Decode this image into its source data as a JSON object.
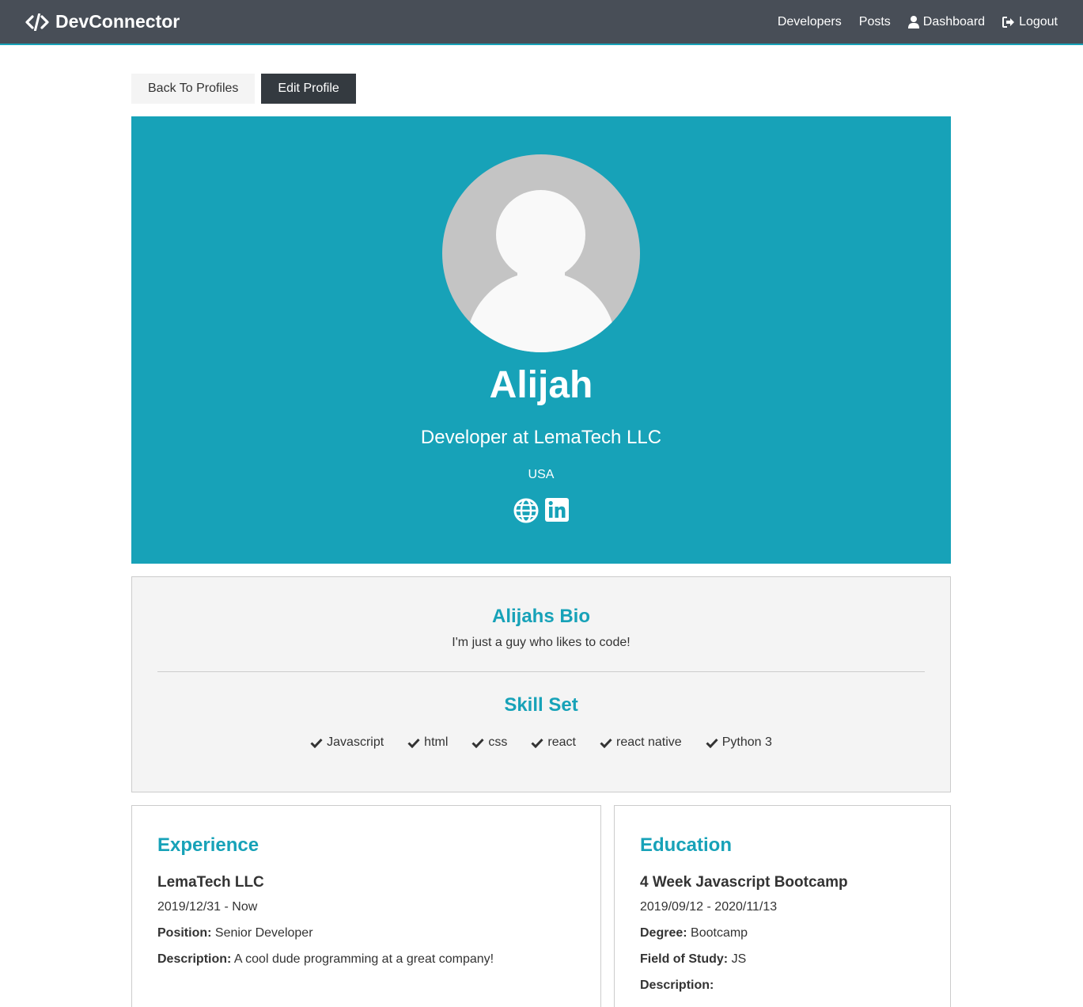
{
  "navbar": {
    "brand": "DevConnector",
    "links": {
      "developers": "Developers",
      "posts": "Posts",
      "dashboard": "Dashboard",
      "logout": "Logout"
    }
  },
  "actions": {
    "back": "Back To Profiles",
    "edit": "Edit Profile"
  },
  "profile": {
    "name": "Alijah",
    "status": "Developer at LemaTech LLC",
    "location": "USA",
    "social_icons": [
      "globe-icon",
      "linkedin-icon"
    ]
  },
  "about": {
    "bio_title": "Alijahs Bio",
    "bio": "I'm just a guy who likes to code!",
    "skills_title": "Skill Set",
    "skills": [
      "Javascript",
      "html",
      "css",
      "react",
      "react native",
      "Python 3"
    ]
  },
  "experience": {
    "title": "Experience",
    "company": "LemaTech LLC",
    "dates": "2019/12/31 - Now",
    "position_label": "Position:",
    "position": "Senior Developer",
    "description_label": "Description:",
    "description": "A cool dude programming at a great company!"
  },
  "education": {
    "title": "Education",
    "school": "4 Week Javascript Bootcamp",
    "dates": "2019/09/12 - 2020/11/13",
    "degree_label": "Degree:",
    "degree": "Bootcamp",
    "field_label": "Field of Study:",
    "field": "JS",
    "description_label": "Description:"
  },
  "colors": {
    "primary": "#17a2b8",
    "navbar": "#484e57",
    "dark": "#343a40",
    "light": "#f4f4f4"
  }
}
